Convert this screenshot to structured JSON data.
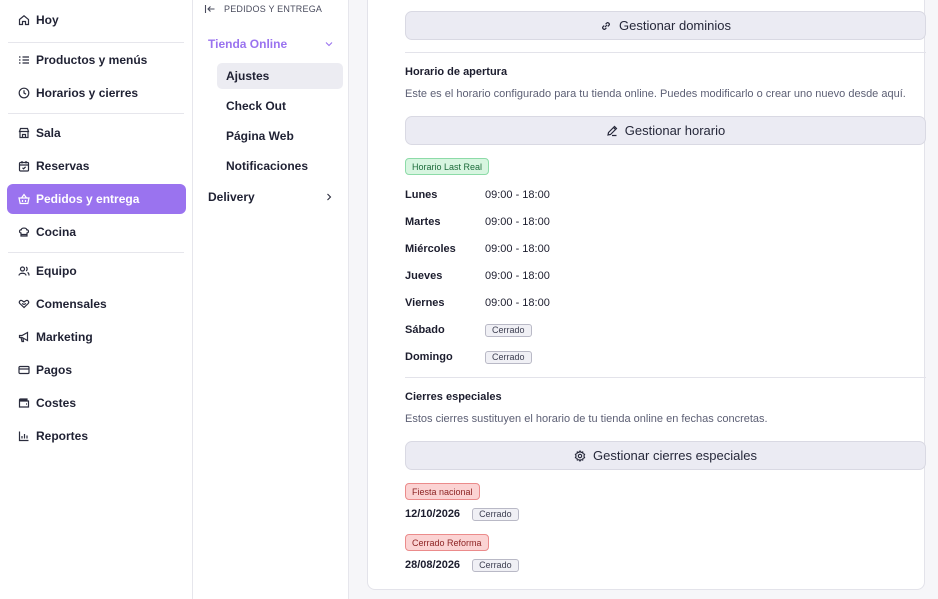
{
  "nav": {
    "items": [
      {
        "label": "Hoy",
        "icon": "home-icon"
      },
      {
        "label": "Productos y menús",
        "icon": "list-icon"
      },
      {
        "label": "Horarios y cierres",
        "icon": "clock-icon"
      },
      {
        "label": "Sala",
        "icon": "store-icon"
      },
      {
        "label": "Reservas",
        "icon": "calendar-icon"
      },
      {
        "label": "Pedidos y entrega",
        "icon": "basket-icon"
      },
      {
        "label": "Cocina",
        "icon": "chef-hat-icon"
      },
      {
        "label": "Equipo",
        "icon": "users-icon"
      },
      {
        "label": "Comensales",
        "icon": "heart-hands-icon"
      },
      {
        "label": "Marketing",
        "icon": "megaphone-icon"
      },
      {
        "label": "Pagos",
        "icon": "credit-card-icon"
      },
      {
        "label": "Costes",
        "icon": "wallet-icon"
      },
      {
        "label": "Reportes",
        "icon": "bar-chart-icon"
      }
    ],
    "active_index": 5,
    "accent": "#9a73ef"
  },
  "subnav": {
    "header": "PEDIDOS Y ENTREGA",
    "group_online": "Tienda Online",
    "items": [
      "Ajustes",
      "Check Out",
      "Página Web",
      "Notificaciones"
    ],
    "active_item": "Ajustes",
    "group_delivery": "Delivery"
  },
  "content": {
    "domains_button": "Gestionar dominios",
    "opening": {
      "title": "Horario de apertura",
      "description": "Este es el horario configurado para tu tienda online. Puedes modificarlo o crear uno nuevo desde aquí.",
      "button": "Gestionar horario",
      "schedule_name": "Horario Last Real",
      "days": [
        {
          "day": "Lunes",
          "hours": "09:00 - 18:00"
        },
        {
          "day": "Martes",
          "hours": "09:00 - 18:00"
        },
        {
          "day": "Miércoles",
          "hours": "09:00 - 18:00"
        },
        {
          "day": "Jueves",
          "hours": "09:00 - 18:00"
        },
        {
          "day": "Viernes",
          "hours": "09:00 - 18:00"
        },
        {
          "day": "Sábado",
          "status": "Cerrado"
        },
        {
          "day": "Domingo",
          "status": "Cerrado"
        }
      ]
    },
    "closures": {
      "title": "Cierres especiales",
      "description": "Estos cierres sustituyen el horario de tu tienda online en fechas concretas.",
      "button": "Gestionar cierres especiales",
      "entries": [
        {
          "name": "Fiesta nacional",
          "date": "12/10/2026",
          "status": "Cerrado"
        },
        {
          "name": "Cerrado Reforma",
          "date": "28/08/2026",
          "status": "Cerrado"
        }
      ]
    }
  }
}
